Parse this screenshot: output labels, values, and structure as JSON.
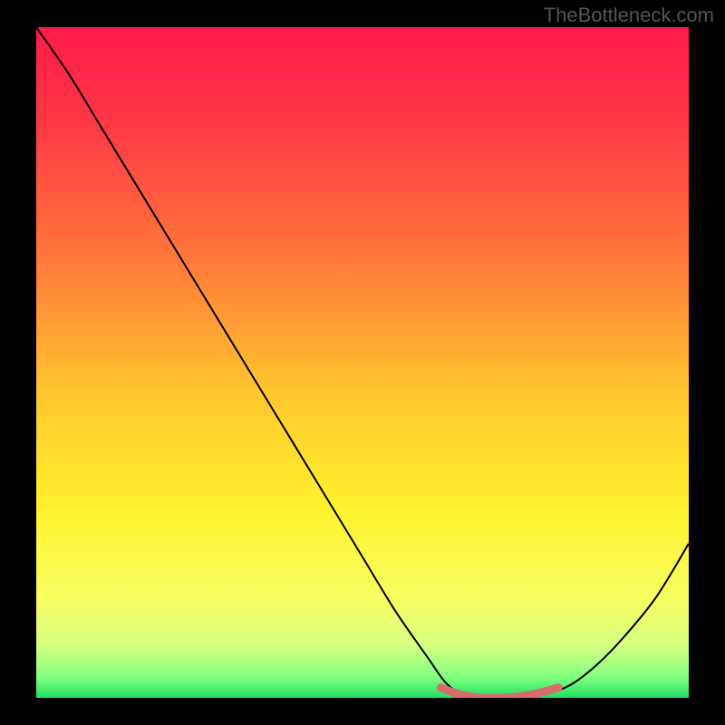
{
  "attribution": "TheBottleneck.com",
  "chart_data": {
    "type": "line",
    "title": "",
    "xlabel": "",
    "ylabel": "",
    "xlim": [
      0,
      100
    ],
    "ylim": [
      0,
      100
    ],
    "series": [
      {
        "name": "bottleneck-curve",
        "color": "#000000",
        "x": [
          0,
          5,
          10,
          15,
          20,
          25,
          30,
          35,
          40,
          45,
          50,
          55,
          60,
          63,
          66,
          70,
          74,
          78,
          82,
          86,
          90,
          95,
          100
        ],
        "y": [
          100,
          93,
          85,
          77,
          69,
          61,
          53,
          45,
          37,
          29,
          21,
          13,
          6,
          2,
          0.5,
          0,
          0,
          0.5,
          2,
          5,
          9,
          15,
          23
        ]
      },
      {
        "name": "optimal-zone-highlight",
        "color": "#d86b6b",
        "x": [
          62,
          65,
          68,
          72,
          76,
          80
        ],
        "y": [
          1.5,
          0.5,
          0,
          0,
          0.5,
          1.5
        ]
      }
    ],
    "gradient_stops": [
      {
        "offset": 0,
        "color": "#ff1a4a"
      },
      {
        "offset": 15,
        "color": "#ff3a45"
      },
      {
        "offset": 35,
        "color": "#ff7a3a"
      },
      {
        "offset": 55,
        "color": "#ffc82e"
      },
      {
        "offset": 72,
        "color": "#fff22e"
      },
      {
        "offset": 85,
        "color": "#f8ff60"
      },
      {
        "offset": 92,
        "color": "#d8ff80"
      },
      {
        "offset": 97,
        "color": "#80ff80"
      },
      {
        "offset": 100,
        "color": "#20e060"
      }
    ]
  }
}
